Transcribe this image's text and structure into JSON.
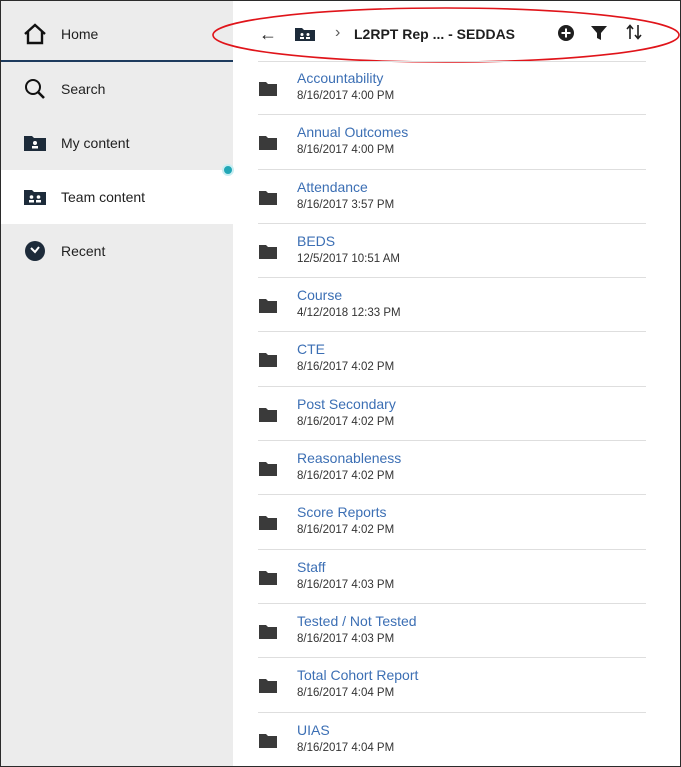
{
  "sidebar": {
    "items": [
      {
        "label": "Home",
        "icon": "home-icon"
      },
      {
        "label": "Search",
        "icon": "search-icon"
      },
      {
        "label": "My content",
        "icon": "folder-user-icon"
      },
      {
        "label": "Team content",
        "icon": "folder-team-icon"
      },
      {
        "label": "Recent",
        "icon": "clock-icon"
      }
    ]
  },
  "toolbar": {
    "back_icon": "arrow-left-icon",
    "breadcrumb": "L2RPT Rep ... - SEDDAS",
    "add_icon": "add-circle-icon",
    "filter_icon": "filter-icon",
    "sort_icon": "sort-icon"
  },
  "colors": {
    "link": "#3c6fb4",
    "sidebar_bg": "#ececec",
    "annotation": "#e0141a",
    "notification": "#22a7b6"
  },
  "folders": [
    {
      "name": "Accountability",
      "date": "8/16/2017 4:00 PM"
    },
    {
      "name": "Annual Outcomes",
      "date": "8/16/2017 4:00 PM"
    },
    {
      "name": "Attendance",
      "date": "8/16/2017 3:57 PM"
    },
    {
      "name": "BEDS",
      "date": "12/5/2017 10:51 AM"
    },
    {
      "name": "Course",
      "date": "4/12/2018 12:33 PM"
    },
    {
      "name": "CTE",
      "date": "8/16/2017 4:02 PM"
    },
    {
      "name": "Post Secondary",
      "date": "8/16/2017 4:02 PM"
    },
    {
      "name": "Reasonableness",
      "date": "8/16/2017 4:02 PM"
    },
    {
      "name": "Score Reports",
      "date": "8/16/2017 4:02 PM"
    },
    {
      "name": "Staff",
      "date": "8/16/2017 4:03 PM"
    },
    {
      "name": "Tested / Not Tested",
      "date": "8/16/2017 4:03 PM"
    },
    {
      "name": "Total Cohort Report",
      "date": "8/16/2017 4:04 PM"
    },
    {
      "name": "UIAS",
      "date": "8/16/2017 4:04 PM"
    }
  ]
}
